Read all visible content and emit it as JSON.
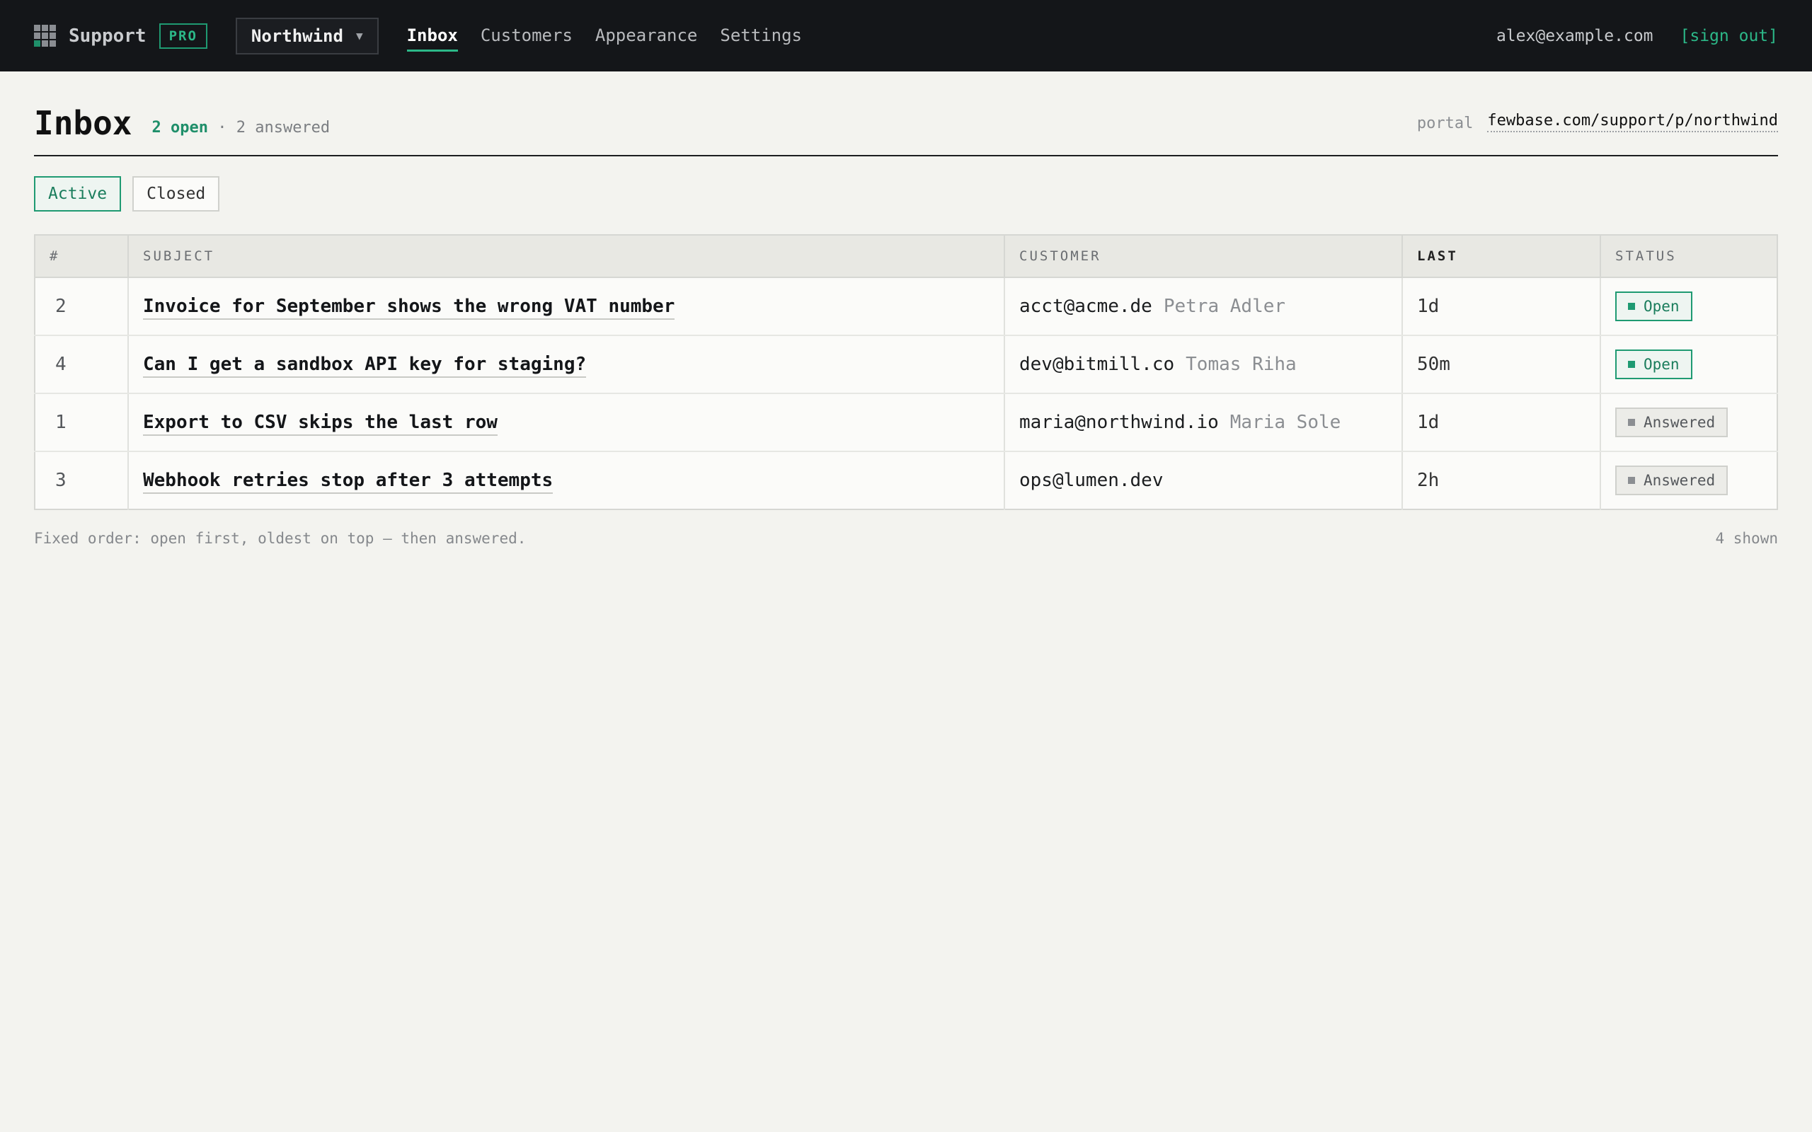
{
  "brand": {
    "name": "Support",
    "plan": "PRO"
  },
  "project": {
    "name": "Northwind",
    "caret": "▼"
  },
  "nav": [
    {
      "label": "Inbox",
      "active": true
    },
    {
      "label": "Customers",
      "active": false
    },
    {
      "label": "Appearance",
      "active": false
    },
    {
      "label": "Settings",
      "active": false
    }
  ],
  "user": {
    "email": "alex@example.com",
    "signout": "[sign out]"
  },
  "page": {
    "title": "Inbox",
    "open_count": "2 open",
    "separator": "·",
    "answered_count": "2 answered",
    "portal_label": "portal",
    "portal_url": "fewbase.com/support/p/northwind"
  },
  "filters": [
    {
      "label": "Active",
      "active": true
    },
    {
      "label": "Closed",
      "active": false
    }
  ],
  "table": {
    "headers": [
      "#",
      "SUBJECT",
      "CUSTOMER",
      "LAST",
      "STATUS"
    ],
    "rows": [
      {
        "num": "2",
        "subject": "Invoice for September shows the wrong VAT number",
        "email": "acct@acme.de",
        "name": "Petra Adler",
        "last": "1d",
        "status": "Open"
      },
      {
        "num": "4",
        "subject": "Can I get a sandbox API key for staging?",
        "email": "dev@bitmill.co",
        "name": "Tomas Riha",
        "last": "50m",
        "status": "Open"
      },
      {
        "num": "1",
        "subject": "Export to CSV skips the last row",
        "email": "maria@northwind.io",
        "name": "Maria Sole",
        "last": "1d",
        "status": "Answered"
      },
      {
        "num": "3",
        "subject": "Webhook retries stop after 3 attempts",
        "email": "ops@lumen.dev",
        "name": "",
        "last": "2h",
        "status": "Answered"
      }
    ]
  },
  "footer": {
    "note": "Fixed order: open first, oldest on top — then answered.",
    "shown": "4 shown"
  },
  "colors": {
    "accent": "#1f9a72",
    "topbar": "#141619",
    "background": "#f3f3ef"
  }
}
